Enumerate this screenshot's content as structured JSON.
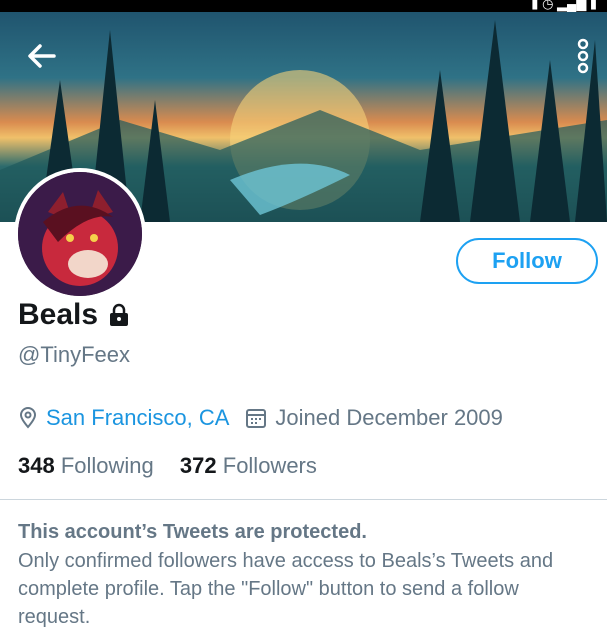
{
  "profile": {
    "name": "Beals",
    "handle": "@TinyFeex",
    "location": "San Francisco, CA",
    "joined": "Joined December 2009",
    "following_count": "348",
    "following_label": "Following",
    "followers_count": "372",
    "followers_label": "Followers"
  },
  "actions": {
    "follow_label": "Follow"
  },
  "notice": {
    "title": "This account’s Tweets are protected.",
    "body": "Only confirmed followers have access to Beals’s Tweets and complete profile. Tap the \"Follow\" button to send a follow request."
  },
  "colors": {
    "accent": "#1da1f2",
    "link": "#1b95e0",
    "muted": "#657786"
  },
  "icons": {
    "back": "arrow-left-icon",
    "more": "more-vertical-icon",
    "lock": "lock-icon",
    "location": "location-pin-icon",
    "calendar": "calendar-icon"
  }
}
